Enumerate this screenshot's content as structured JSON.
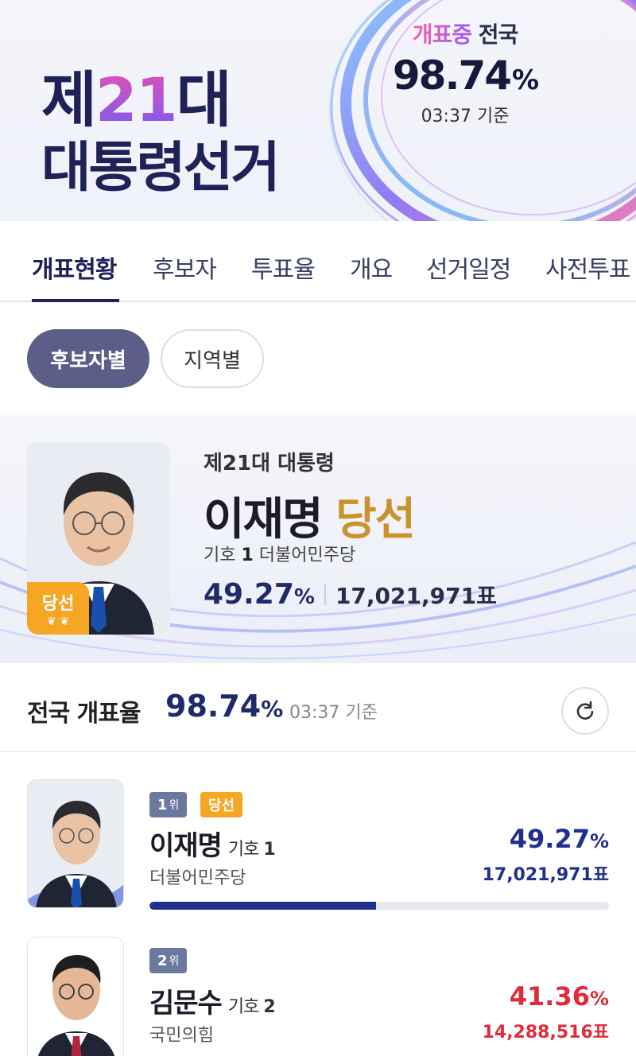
{
  "header": {
    "title_line1_prefix": "제",
    "title_line1_number": "21",
    "title_line1_suffix": "대",
    "title_line2": "대통령선거",
    "count_status": "개표중",
    "count_scope": "전국",
    "count_percent": "98.74",
    "count_percent_unit": "%",
    "count_time": "03:37 기준"
  },
  "tabs": [
    {
      "label": "개표현황",
      "active": true
    },
    {
      "label": "후보자",
      "active": false
    },
    {
      "label": "투표율",
      "active": false
    },
    {
      "label": "개요",
      "active": false
    },
    {
      "label": "선거일정",
      "active": false
    },
    {
      "label": "사전투표",
      "active": false
    }
  ],
  "filters": {
    "by_candidate": "후보자별",
    "by_region": "지역별"
  },
  "winner": {
    "subtitle": "제21대 대통령",
    "name": "이재명",
    "elected": "당선",
    "badge": "당선",
    "number_label": "기호",
    "number": "1",
    "party": "더불어민주당",
    "percent": "49.27",
    "percent_unit": "%",
    "votes": "17,021,971표"
  },
  "nation": {
    "label": "전국 개표율",
    "percent": "98.74",
    "percent_unit": "%",
    "time": "03:37 기준"
  },
  "candidates": [
    {
      "rank": "1",
      "rank_suffix": "위",
      "tag": "당선",
      "name": "이재명",
      "number_label": "기호",
      "number": "1",
      "party": "더불어민주당",
      "percent": "49.27",
      "percent_unit": "%",
      "votes": "17,021,971표",
      "share": 0.4927,
      "color": "#1f2f8c"
    },
    {
      "rank": "2",
      "rank_suffix": "위",
      "name": "김문수",
      "number_label": "기호",
      "number": "2",
      "party": "국민의힘",
      "percent": "41.36",
      "percent_unit": "%",
      "votes": "14,288,516표",
      "share": 0.4136,
      "color": "#e02b3a"
    }
  ],
  "icons": {
    "refresh": "refresh-icon",
    "laurel": "laurel-icon"
  }
}
